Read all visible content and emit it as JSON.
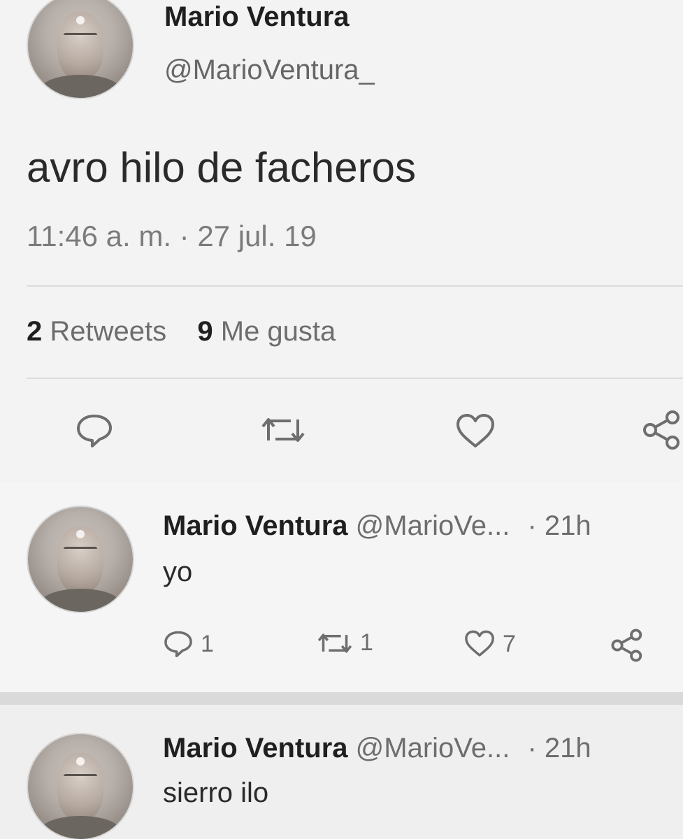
{
  "tweet": {
    "display_name": "Mario Ventura",
    "handle": "@MarioVentura_",
    "text": "avro hilo de facheros",
    "timestamp": "11:46 a. m. · 27 jul. 19",
    "stats": {
      "retweets_count": "2",
      "retweets_label": "Retweets",
      "likes_count": "9",
      "likes_label": "Me gusta"
    }
  },
  "replies": [
    {
      "display_name": "Mario Ventura",
      "handle": "@MarioVe...",
      "time": "· 21h",
      "text": "yo",
      "reply_count": "1",
      "retweet_count": "1",
      "like_count": "7"
    },
    {
      "display_name": "Mario Ventura",
      "handle": "@MarioVe...",
      "time": "· 21h",
      "text": "sierro ilo"
    }
  ],
  "icons": {
    "reply": "speech-bubble-icon",
    "retweet": "retweet-icon",
    "like": "heart-icon",
    "share": "share-icon"
  },
  "colors": {
    "background": "#ececec",
    "text": "#222222",
    "muted": "#7b7b7b",
    "divider": "#dcdcdc"
  }
}
